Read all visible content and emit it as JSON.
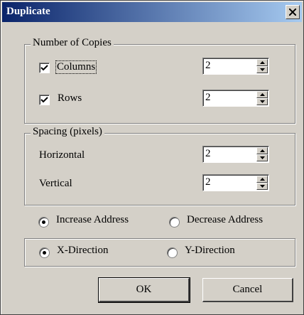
{
  "window": {
    "title": "Duplicate"
  },
  "copies_group": {
    "legend": "Number of Copies",
    "columns": {
      "label": "Columns",
      "checked": true,
      "value": "2"
    },
    "rows": {
      "label": "Rows",
      "checked": true,
      "value": "2"
    }
  },
  "spacing_group": {
    "legend": "Spacing (pixels)",
    "horizontal": {
      "label": "Horizontal",
      "value": "2"
    },
    "vertical": {
      "label": "Vertical",
      "value": "2"
    }
  },
  "address": {
    "increase_label": "Increase Address",
    "decrease_label": "Decrease Address",
    "selected": "increase"
  },
  "direction": {
    "x_label": "X-Direction",
    "y_label": "Y-Direction",
    "selected": "x"
  },
  "buttons": {
    "ok": "OK",
    "cancel": "Cancel"
  }
}
